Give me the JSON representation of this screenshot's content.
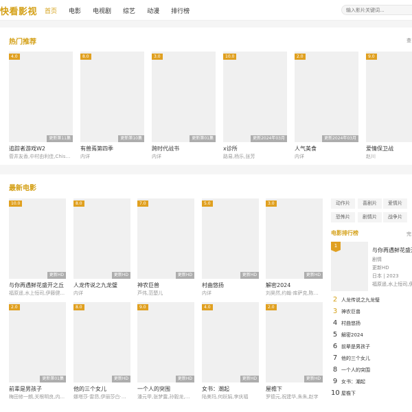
{
  "site": {
    "logo": "快看影视"
  },
  "nav": [
    {
      "label": "首页",
      "active": true
    },
    {
      "label": "电影"
    },
    {
      "label": "电视剧"
    },
    {
      "label": "综艺"
    },
    {
      "label": "动漫"
    },
    {
      "label": "排行榜"
    }
  ],
  "search": {
    "placeholder": "输入影片关键词..."
  },
  "hot": {
    "title": "热门推荐",
    "more": "查",
    "items": [
      {
        "score": "4.0",
        "update": "更新第11集",
        "title": "追踪者游戏W2",
        "sub": "菅井友香,中村由利佳,Chiso,..."
      },
      {
        "score": "8.0",
        "update": "更新第10集",
        "title": "有兽焉第四季",
        "sub": "内详"
      },
      {
        "score": "3.0",
        "update": "更新第01集",
        "title": "跨时代战书",
        "sub": "内详"
      },
      {
        "score": "10.0",
        "update": "更新2024年03月",
        "title": "x诊所",
        "sub": "路易,杨乐,张芳"
      },
      {
        "score": "2.0",
        "update": "更新2024年03月",
        "title": "人气美食",
        "sub": "内详"
      },
      {
        "score": "9.0",
        "update": "更新",
        "title": "爱情保卫战",
        "sub": "赵川"
      }
    ]
  },
  "latest": {
    "title": "最新电影",
    "items": [
      {
        "score": "10.0",
        "update": "更新HD",
        "title": "与你再遇鲜花盛开之丘",
        "sub": "福原遥,水上恒司,伊藤健..."
      },
      {
        "score": "8.0",
        "update": "更新HD",
        "title": "人龙传说之九龙璧",
        "sub": "内详"
      },
      {
        "score": "7.0",
        "update": "更新HD",
        "title": "神农巨兽",
        "sub": "芦伟,范楚儿"
      },
      {
        "score": "5.0",
        "update": "更新HD",
        "title": "村曲悠扬",
        "sub": "内详"
      },
      {
        "score": "3.0",
        "update": "更新HD",
        "title": "解密2024",
        "sub": "刘昊然,约翰·库萨克,陈道..."
      },
      {
        "score": "2.0",
        "update": "更新第01集",
        "title": "前辈是男孩子",
        "sub": "梅田修一朗,关根明良,内..."
      },
      {
        "score": "8.0",
        "update": "更新HD",
        "title": "他的三个女儿",
        "sub": "娜塔莎·雷昂,伊丽莎白·奥..."
      },
      {
        "score": "9.0",
        "update": "更新HD",
        "title": "一个人的突围",
        "sub": "潘元甲,张梦露,孙毅龙,胡..."
      },
      {
        "score": "4.0",
        "update": "更新HD",
        "title": "女书：潮起",
        "sub": "陆美玛,何跃娟,李庆福"
      },
      {
        "score": "2.0",
        "update": "更新HD",
        "title": "屋檐下",
        "sub": "罗德元,祝建华,朱朱,赵字"
      }
    ]
  },
  "genres": [
    "动作片",
    "喜剧片",
    "爱情片",
    "恐怖片",
    "剧情片",
    "战争片"
  ],
  "ranking": {
    "title": "电影排行榜",
    "more": "完",
    "top": {
      "rank": "1",
      "title": "与你再遇鲜花盛开",
      "genre": "剧情",
      "update": "更新HD",
      "meta": "日本 | 2023",
      "cast": "福原遥,水上恒司,伊"
    },
    "items": [
      {
        "rank": "2",
        "name": "人龙传说之九龙璧"
      },
      {
        "rank": "3",
        "name": "神农巨兽"
      },
      {
        "rank": "4",
        "name": "村曲悠扬"
      },
      {
        "rank": "5",
        "name": "解密2024"
      },
      {
        "rank": "6",
        "name": "前辈是男孩子"
      },
      {
        "rank": "7",
        "name": "他的三个女儿"
      },
      {
        "rank": "8",
        "name": "一个人的突围"
      },
      {
        "rank": "9",
        "name": "女书：潮起"
      },
      {
        "rank": "10",
        "name": "屋檐下"
      }
    ]
  },
  "colors": {
    "accent": "#d4a017",
    "badge": "#e0a020"
  }
}
